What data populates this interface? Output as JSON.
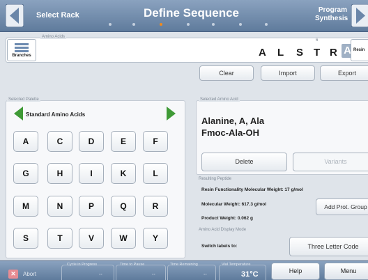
{
  "nav": {
    "prev_step": "Select Rack",
    "current_step": "Define Sequence",
    "next_step_line1": "Program",
    "next_step_line2": "Synthesis"
  },
  "sequence": {
    "group_label": "Amino Acids",
    "branches_label": "Branches",
    "letters": [
      "A",
      "L",
      "S",
      "T",
      "R",
      "A"
    ],
    "selected_position": "6",
    "resin_label": "Resin"
  },
  "actions": {
    "clear": "Clear",
    "import": "Import",
    "export": "Export"
  },
  "palette": {
    "group_label": "Selected Palette",
    "name": "Standard Amino Acids",
    "keys": [
      "A",
      "C",
      "D",
      "E",
      "F",
      "G",
      "H",
      "I",
      "K",
      "L",
      "M",
      "N",
      "P",
      "Q",
      "R",
      "S",
      "T",
      "V",
      "W",
      "Y"
    ]
  },
  "selected_amino_acid": {
    "group_label": "Selected Amino Acid",
    "name": "Alanine, A, Ala",
    "formula": "Fmoc-Ala-OH",
    "delete_label": "Delete",
    "variants_label": "Variants"
  },
  "resulting_peptide": {
    "group_label": "Resulting Peptide",
    "resin_mw": "Resin Functionality Molecular Weight: 17 g/mol",
    "mw": "Molecular Weight: 617.3 g/mol",
    "product_weight": "Product Weight: 0.062 g",
    "add_prot_label": "Add Prot. Group"
  },
  "display_mode": {
    "group_label": "Amino Acid Display Mode",
    "switch_label": "Switch labels to:",
    "button_label": "Three Letter Code"
  },
  "status": {
    "abort_label": "Abort",
    "cycle_label": "Cycle in Progress",
    "cycle_value": "--",
    "pause_label": "Time to Pause",
    "pause_value": "--",
    "remaining_label": "Time Remaining",
    "remaining_value": "--",
    "temp_label": "Vial Temperature",
    "temp_value": "31°C",
    "help_label": "Help",
    "menu_label": "Menu"
  },
  "colors": {
    "accent": "#f08a1c",
    "nav_arrow": "#6a86a9",
    "palette_arrow": "#3f9a36"
  }
}
